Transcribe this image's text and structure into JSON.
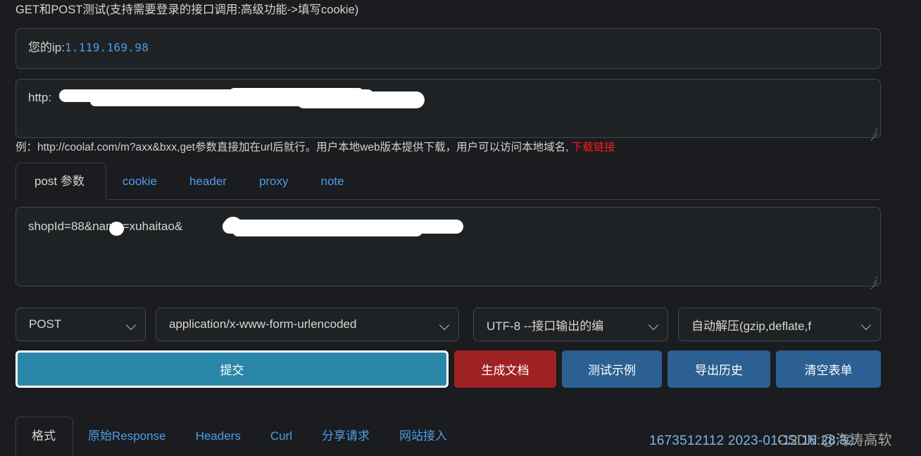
{
  "page": {
    "title": "GET和POST测试(支持需要登录的接口调用:高级功能->填写cookie)"
  },
  "ip_panel": {
    "label": "您的ip:",
    "value": "1.119.169.98"
  },
  "url_field": {
    "value": "http:"
  },
  "hint": {
    "text": "例：http://coolaf.com/m?axx&bxx,get参数直接加在url后就行。用户本地web版本提供下载，用户可以访问本地域名, ",
    "link_label": "下载链接",
    "link_color": "#ff1a1a"
  },
  "request_tabs": {
    "items": [
      {
        "label": "post 参数",
        "active": true
      },
      {
        "label": "cookie",
        "active": false
      },
      {
        "label": "header",
        "active": false
      },
      {
        "label": "proxy",
        "active": false
      },
      {
        "label": "note",
        "active": false
      }
    ]
  },
  "body_field": {
    "value": "shopId=88&name=xuhaitao&"
  },
  "selects": {
    "method": "POST",
    "content_type": "application/x-www-form-urlencoded",
    "charset": "UTF-8 --接口输出的编",
    "compression": "自动解压(gzip,deflate,f"
  },
  "buttons": {
    "submit": "提交",
    "generate_doc": "生成文档",
    "test_example": "测试示例",
    "export_history": "导出历史",
    "clear_form": "清空表单",
    "submit_color": "#2b87a8",
    "generate_doc_color": "#9e2222",
    "secondary_color": "#2c5f92"
  },
  "response_tabs": {
    "items": [
      {
        "label": "格式",
        "active": true
      },
      {
        "label": "原始Response",
        "active": false
      },
      {
        "label": "Headers",
        "active": false
      },
      {
        "label": "Curl",
        "active": false
      },
      {
        "label": "分享请求",
        "active": false
      },
      {
        "label": "网站接入",
        "active": false
      }
    ]
  },
  "footer": {
    "timestamp": "1673512112 2023-01-12 16:28:32",
    "watermark": "CSDN @海涛高软"
  }
}
